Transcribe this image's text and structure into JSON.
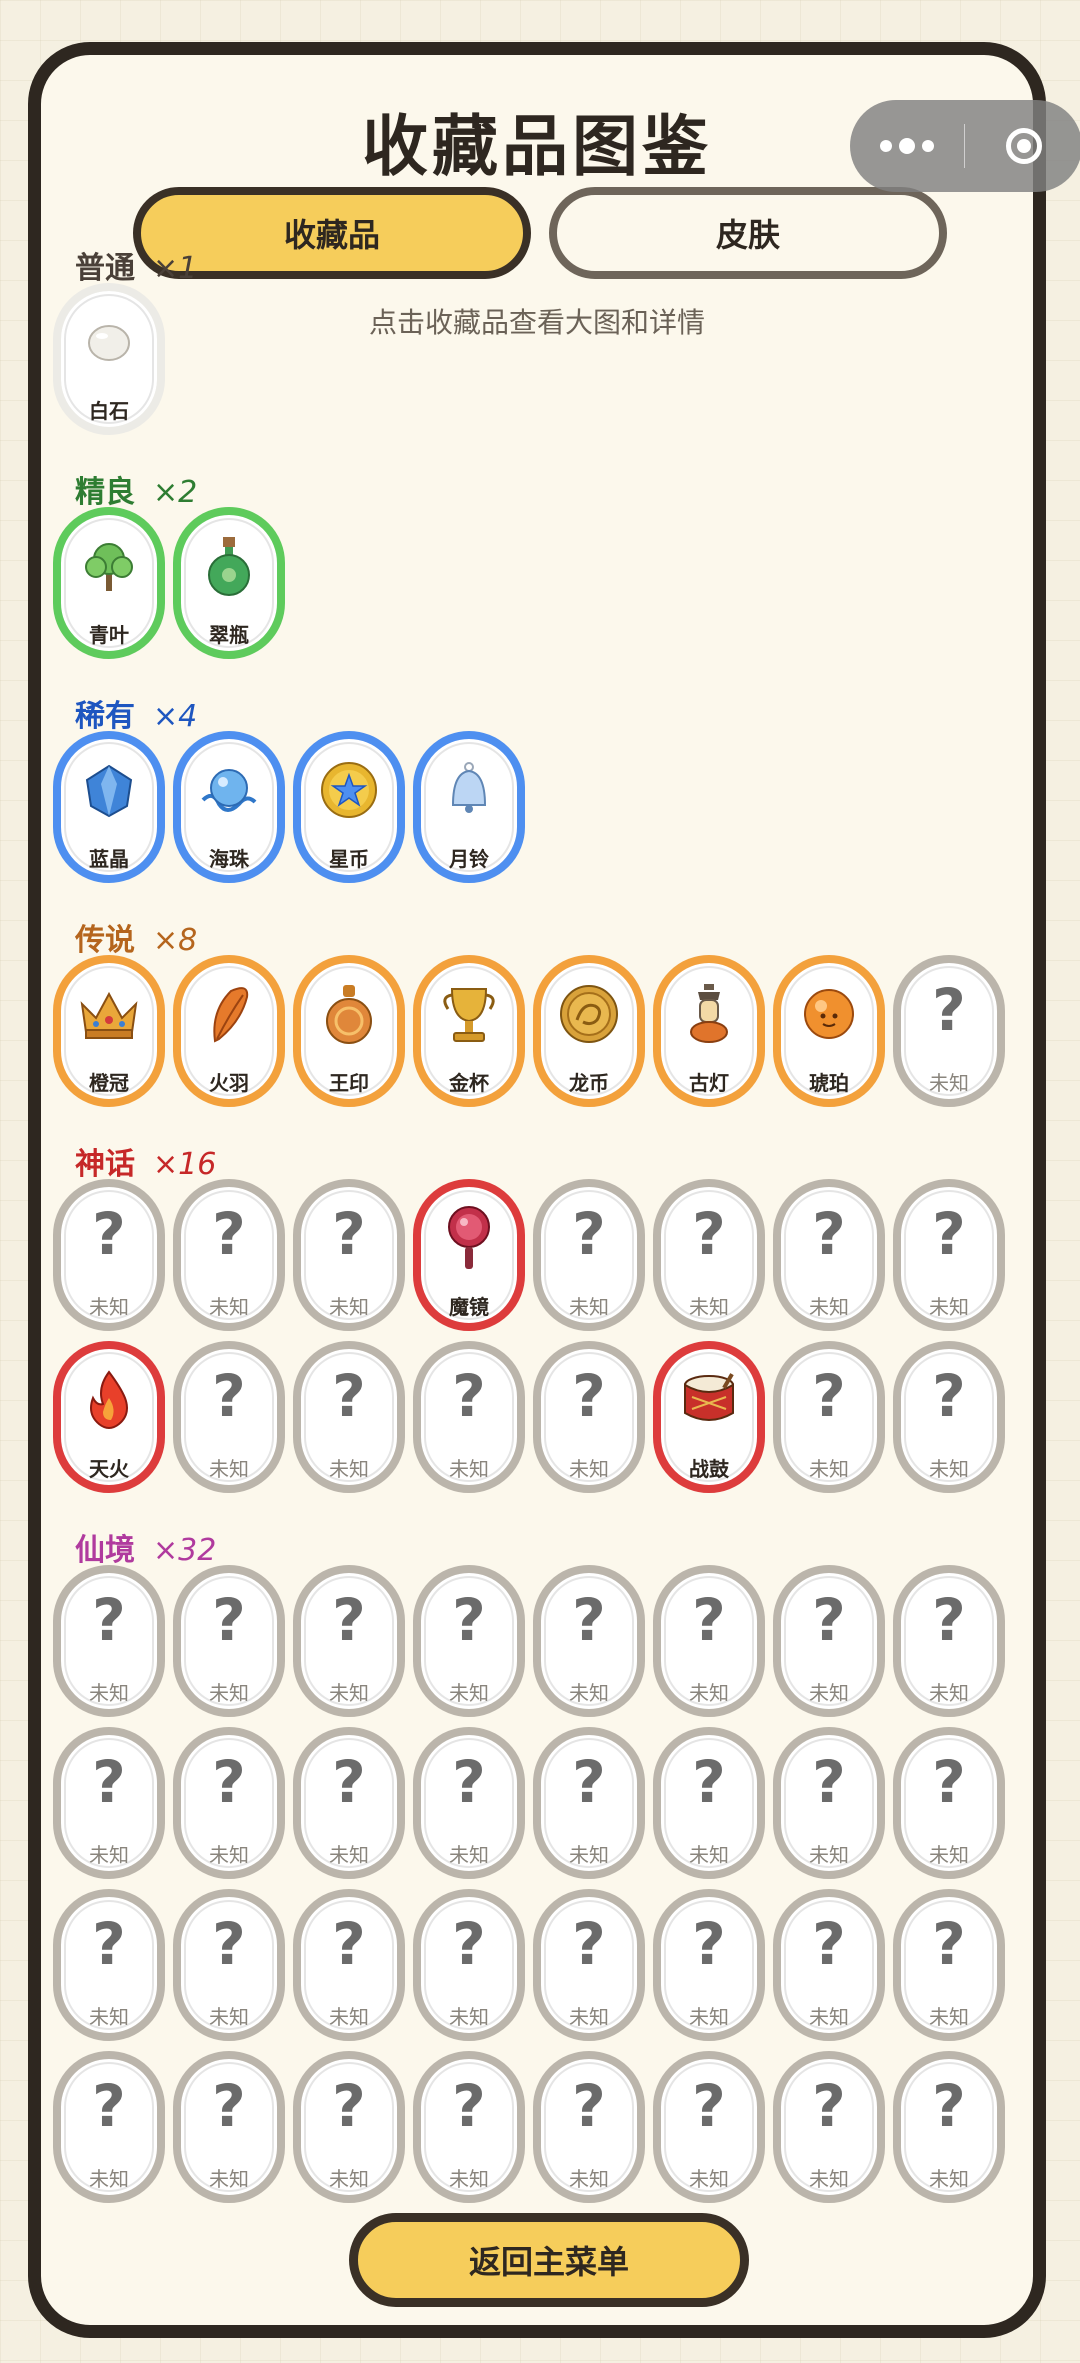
{
  "title": "收藏品图鉴",
  "tabs": {
    "collectibles": "收藏品",
    "skins": "皮肤"
  },
  "hint": "点击收藏品查看大图和详情",
  "unknown_label": "未知",
  "unknown_mark": "?",
  "back_button": "返回主菜单",
  "colors": {
    "common": "#4a4038",
    "fine": "#2e7d32",
    "rare": "#1e56c0",
    "legendary": "#b5651d",
    "mythic": "#c62828",
    "fairy": "#b03a9e"
  },
  "sections": [
    {
      "label": "普通",
      "count": "×1",
      "rarity": "white",
      "color": "#4a4038",
      "items": [
        {
          "name": "白石",
          "icon": "white-stone-icon"
        }
      ]
    },
    {
      "label": "精良",
      "count": "×2",
      "rarity": "green",
      "color": "#2e7d32",
      "items": [
        {
          "name": "青叶",
          "icon": "green-leaf-icon"
        },
        {
          "name": "翠瓶",
          "icon": "jade-bottle-icon"
        }
      ]
    },
    {
      "label": "稀有",
      "count": "×4",
      "rarity": "blue",
      "color": "#1e56c0",
      "items": [
        {
          "name": "蓝晶",
          "icon": "blue-crystal-icon"
        },
        {
          "name": "海珠",
          "icon": "sea-pearl-icon"
        },
        {
          "name": "星币",
          "icon": "star-coin-icon"
        },
        {
          "name": "月铃",
          "icon": "moon-bell-icon"
        }
      ]
    },
    {
      "label": "传说",
      "count": "×8",
      "rarity": "orange",
      "color": "#b5651d",
      "items": [
        {
          "name": "橙冠",
          "icon": "crown-icon"
        },
        {
          "name": "火羽",
          "icon": "fire-feather-icon"
        },
        {
          "name": "王印",
          "icon": "royal-seal-icon"
        },
        {
          "name": "金杯",
          "icon": "golden-cup-icon"
        },
        {
          "name": "龙币",
          "icon": "dragon-coin-icon"
        },
        {
          "name": "古灯",
          "icon": "ancient-lamp-icon"
        },
        {
          "name": "琥珀",
          "icon": "amber-icon"
        },
        null
      ]
    },
    {
      "label": "神话",
      "count": "×16",
      "rarity": "red",
      "color": "#c62828",
      "items": [
        null,
        null,
        null,
        {
          "name": "魔镜",
          "icon": "magic-mirror-icon"
        },
        null,
        null,
        null,
        null,
        {
          "name": "天火",
          "icon": "heaven-fire-icon"
        },
        null,
        null,
        null,
        null,
        {
          "name": "战鼓",
          "icon": "war-drum-icon"
        },
        null,
        null
      ]
    },
    {
      "label": "仙境",
      "count": "×32",
      "rarity": "gray",
      "color": "#b03a9e",
      "items": [
        null,
        null,
        null,
        null,
        null,
        null,
        null,
        null,
        null,
        null,
        null,
        null,
        null,
        null,
        null,
        null,
        null,
        null,
        null,
        null,
        null,
        null,
        null,
        null,
        null,
        null,
        null,
        null,
        null,
        null,
        null,
        null
      ]
    }
  ]
}
